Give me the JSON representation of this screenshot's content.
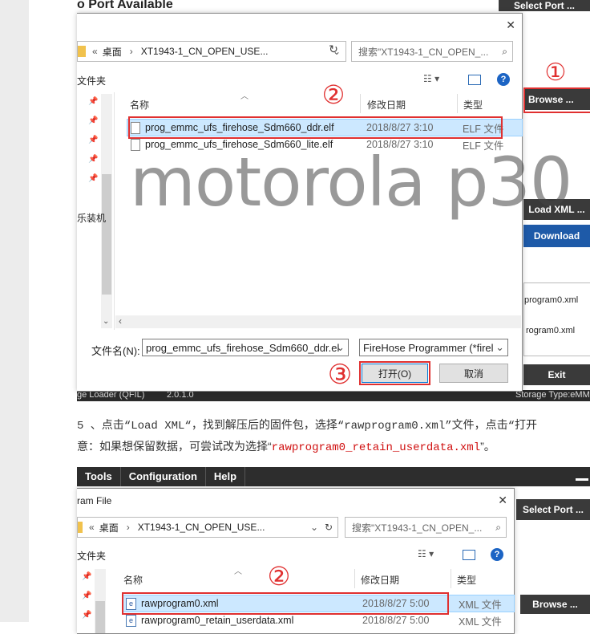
{
  "top_title": "o Port Available",
  "qfil": {
    "select_port": "Select Port ...",
    "browse": "Browse ...",
    "load_xml": "Load XML ...",
    "download": "Download",
    "rawprogram": "program0.xml",
    "patch": "rogram0.xml",
    "exit": "Exit",
    "status_left": "ge Loader (QFIL)",
    "version": "2.0.1.0",
    "status_right": "Storage Type:eMM"
  },
  "dialog1": {
    "breadcrumb_root": "桌面",
    "breadcrumb_folder": "XT1943-1_CN_OPEN_USE...",
    "search_placeholder": "搜索\"XT1943-1_CN_OPEN_...",
    "new_folder": "文件夹",
    "col_name": "名称",
    "col_date": "修改日期",
    "col_type": "类型",
    "files": [
      {
        "name": "prog_emmc_ufs_firehose_Sdm660_ddr.elf",
        "date": "2018/8/27 3:10",
        "type": "ELF 文件"
      },
      {
        "name": "prog_emmc_ufs_firehose_Sdm660_lite.elf",
        "date": "2018/8/27 3:10",
        "type": "ELF 文件"
      }
    ],
    "sidebar_text": "乐装机",
    "filename_label": "文件名(N):",
    "filename_value": "prog_emmc_ufs_firehose_Sdm660_ddr.el",
    "filter_value": "FireHose Programmer (*firel",
    "open_btn": "打开(O)",
    "cancel_btn": "取消",
    "close": "✕"
  },
  "watermark": "motorola p30",
  "step_labels": {
    "one": "①",
    "two": "②",
    "three": "③"
  },
  "instruction_line1": "5 、点击“Load XML“，找到解压后的固件包，选择“rawprogram0.xml”文件，点击“打开",
  "instruction_line2_a": "意：如果想保留数据，可尝试改为选择“",
  "instruction_line2_b": "rawprogram0_retain_userdata.xml",
  "instruction_line2_c": "”。",
  "menubar": [
    "Tools",
    "Configuration",
    "Help"
  ],
  "dialog2": {
    "title": "ram File",
    "breadcrumb_root": "桌面",
    "breadcrumb_folder": "XT1943-1_CN_OPEN_USE...",
    "search_placeholder": "搜索\"XT1943-1_CN_OPEN_...",
    "new_folder": "文件夹",
    "col_name": "名称",
    "col_date": "修改日期",
    "col_type": "类型",
    "files": [
      {
        "name": "rawprogram0.xml",
        "date": "2018/8/27 5:00",
        "type": "XML 文件"
      },
      {
        "name": "rawprogram0_retain_userdata.xml",
        "date": "2018/8/27 5:00",
        "type": "XML 文件"
      }
    ],
    "select_port": "Select Port ...",
    "browse": "Browse ...",
    "close": "✕"
  },
  "colors": {
    "accent": "#e03030",
    "qfil_button": "#3a3a3a",
    "download": "#1e5aa8",
    "selection": "#cce8ff",
    "code": "#d01010"
  }
}
